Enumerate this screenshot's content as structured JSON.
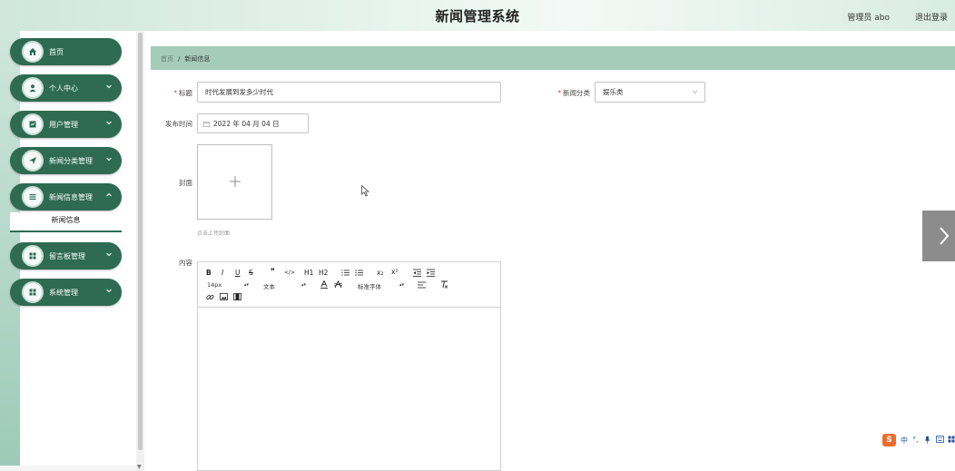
{
  "header": {
    "title": "新闻管理系统",
    "user": "管理员 abo",
    "logout": "退出登录"
  },
  "sidebar": {
    "items": [
      {
        "label": "首页",
        "icon": "home-icon",
        "has_chevron": false
      },
      {
        "label": "个人中心",
        "icon": "user-icon",
        "has_chevron": true
      },
      {
        "label": "用户管理",
        "icon": "users-icon",
        "has_chevron": true
      },
      {
        "label": "新闻分类管理",
        "icon": "send-icon",
        "has_chevron": true
      },
      {
        "label": "新闻信息管理",
        "icon": "list-icon",
        "has_chevron": true
      },
      {
        "label": "留言板管理",
        "icon": "grid-icon",
        "has_chevron": true
      },
      {
        "label": "系统管理",
        "icon": "grid-icon",
        "has_chevron": true
      }
    ],
    "active_sub": "新闻信息"
  },
  "breadcrumb": {
    "home": "首页",
    "separator": "/",
    "current": "新闻信息"
  },
  "form": {
    "title_label": "标题",
    "title_value": "时代发展到发多少时代",
    "category_label": "新闻分类",
    "category_value": "娱乐类",
    "date_label": "发布时间",
    "date_value": "2022 年 04 月 04 日",
    "cover_label": "封面",
    "cover_tip": "点击上传封面",
    "content_label": "内容"
  },
  "editor": {
    "row1": [
      "B",
      "I",
      "U",
      "S",
      "❞",
      "</>",
      "H1",
      "H2",
      "list-ordered",
      "list-bullet",
      "x₂",
      "x²",
      "indent-left",
      "indent-right"
    ],
    "font_size": "14px",
    "paragraph": "文本",
    "font_family": "标准字体"
  },
  "ime": {
    "chars": [
      "中",
      "°,",
      "mic",
      "kbd",
      "app"
    ]
  },
  "colors": {
    "primary": "#2e6b52",
    "accent": "#a4ccb9",
    "header_bg": "#dcefe6"
  }
}
